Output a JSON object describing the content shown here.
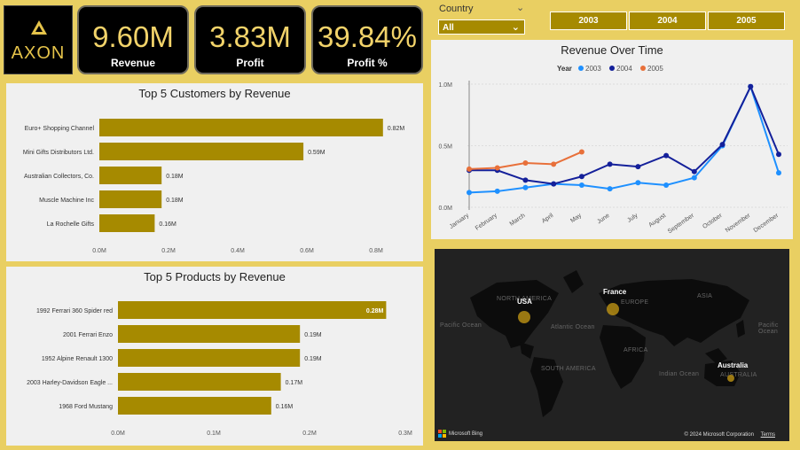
{
  "logo": {
    "text": "AXON"
  },
  "kpis": [
    {
      "value": "9.60M",
      "label": "Revenue"
    },
    {
      "value": "3.83M",
      "label": "Profit"
    },
    {
      "value": "39.84%",
      "label": "Profit %"
    }
  ],
  "filters": {
    "country_title": "Country",
    "country_value": "All",
    "years": [
      "2003",
      "2004",
      "2005"
    ]
  },
  "colors": {
    "gold": "#a68a00",
    "y2003": "#1e90ff",
    "y2004": "#14209a",
    "y2005": "#e8703a"
  },
  "customers_chart": {
    "title": "Top 5 Customers by Revenue",
    "chart_data": {
      "type": "bar",
      "orientation": "horizontal",
      "categories": [
        "Euro+ Shopping Channel",
        "Mini Gifts Distributors Ltd.",
        "Australian Collectors, Co.",
        "Muscle Machine Inc",
        "La Rochelle Gifts"
      ],
      "values": [
        0.82,
        0.59,
        0.18,
        0.18,
        0.16
      ],
      "data_labels": [
        "0.82M",
        "0.59M",
        "0.18M",
        "0.18M",
        "0.16M"
      ],
      "xticks": [
        "0.0M",
        "0.2M",
        "0.4M",
        "0.6M",
        "0.8M"
      ],
      "xlim": [
        0,
        0.8
      ],
      "xunit": "M"
    }
  },
  "products_chart": {
    "title": "Top 5 Products by Revenue",
    "chart_data": {
      "type": "bar",
      "orientation": "horizontal",
      "categories": [
        "1992 Ferrari 360 Spider red",
        "2001 Ferrari Enzo",
        "1952 Alpine Renault 1300",
        "2003 Harley-Davidson Eagle ...",
        "1968 Ford Mustang"
      ],
      "values": [
        0.28,
        0.19,
        0.19,
        0.17,
        0.16
      ],
      "data_labels": [
        "0.28M",
        "0.19M",
        "0.19M",
        "0.17M",
        "0.16M"
      ],
      "xticks": [
        "0.0M",
        "0.1M",
        "0.2M",
        "0.3M"
      ],
      "xlim": [
        0,
        0.3
      ],
      "xunit": "M"
    }
  },
  "revenue_chart": {
    "title": "Revenue Over Time",
    "legend_title": "Year",
    "chart_data": {
      "type": "line",
      "categories": [
        "January",
        "February",
        "March",
        "April",
        "May",
        "June",
        "July",
        "August",
        "September",
        "October",
        "November",
        "December"
      ],
      "yticks": [
        "0.0M",
        "0.5M",
        "1.0M"
      ],
      "ylim": [
        0,
        1.0
      ],
      "series": [
        {
          "name": "2003",
          "color": "#1e90ff",
          "values": [
            0.12,
            0.13,
            0.16,
            0.19,
            0.18,
            0.15,
            0.2,
            0.18,
            0.24,
            0.5,
            0.98,
            0.28
          ]
        },
        {
          "name": "2004",
          "color": "#14209a",
          "values": [
            0.3,
            0.3,
            0.22,
            0.19,
            0.25,
            0.35,
            0.33,
            0.42,
            0.29,
            0.51,
            0.98,
            0.43
          ]
        },
        {
          "name": "2005",
          "color": "#e8703a",
          "values": [
            0.31,
            0.32,
            0.36,
            0.35,
            0.45
          ]
        }
      ]
    }
  },
  "map": {
    "countries": [
      "USA",
      "France",
      "Australia"
    ],
    "regions": [
      "NORTH AMERICA",
      "EUROPE",
      "ASIA",
      "AFRICA",
      "SOUTH AMERICA",
      "AUSTRALIA"
    ],
    "oceans": [
      "Pacific Ocean",
      "Atlantic Ocean",
      "Indian Ocean",
      "Pacific Ocean"
    ],
    "provider": "Microsoft Bing",
    "copyright": "© 2024 Microsoft Corporation",
    "terms": "Terms"
  }
}
